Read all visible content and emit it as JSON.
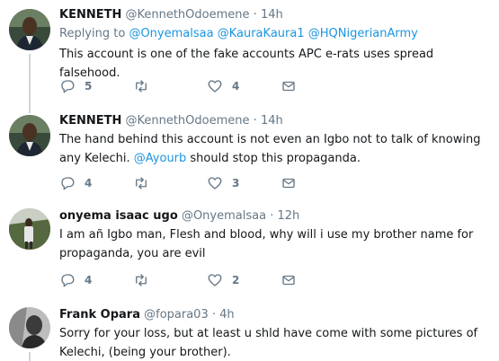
{
  "tweets": [
    {
      "name": "KENNETH",
      "handle": "@KennethOdoemene",
      "dot": "·",
      "time": "14h",
      "replying_prefix": "Replying to",
      "replying_to": [
        "@Onyemalsaa",
        "@KauraKaura1",
        "@HQNigerianArmy"
      ],
      "text": "This account is one of the fake accounts APC e-rats uses spread falsehood.",
      "replies": "5",
      "retweets": "",
      "likes": "4"
    },
    {
      "name": "KENNETH",
      "handle": "@KennethOdoemene",
      "dot": "·",
      "time": "14h",
      "text_before": "The hand behind this account is not even an Igbo not to talk of knowing any Kelechi. ",
      "mention": "@Ayourb",
      "text_after": " should stop this propaganda.",
      "replies": "4",
      "retweets": "",
      "likes": "3"
    },
    {
      "name": "onyema isaac ugo",
      "handle": "@Onyemalsaa",
      "dot": "·",
      "time": "12h",
      "text": "I am añ Igbo man, Flesh and blood, why will i use my brother name for propaganda, you are evil",
      "replies": "4",
      "retweets": "",
      "likes": "2"
    },
    {
      "name": "Frank Opara",
      "handle": "@fopara03",
      "dot": "·",
      "time": "4h",
      "text": "Sorry for your loss, but at least u shld have come with some pictures of Kelechi, (being your brother)."
    }
  ],
  "colors": {
    "link": "#1b95e0",
    "muted": "#657786",
    "rail": "#ccd6dd"
  },
  "icons": [
    "reply-icon",
    "retweet-icon",
    "like-icon",
    "direct-message-icon"
  ]
}
